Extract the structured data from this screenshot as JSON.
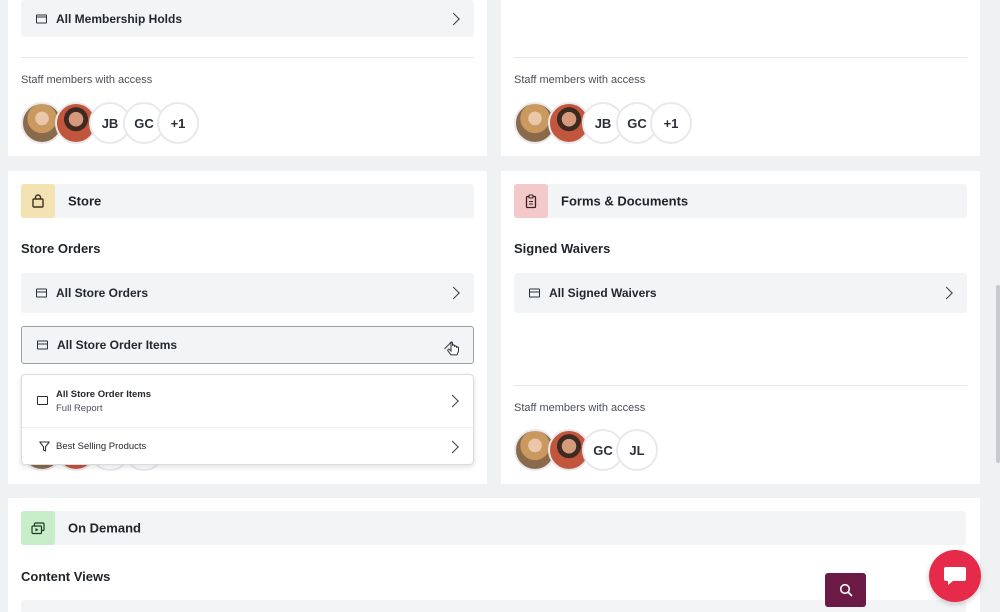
{
  "top_left": {
    "report_row_label": "All Membership Holds",
    "access_label": "Staff members with access",
    "avatars": [
      {
        "type": "photo",
        "name": "staff-photo-1"
      },
      {
        "type": "photo",
        "name": "staff-photo-2"
      },
      {
        "type": "initials",
        "text": "JB"
      },
      {
        "type": "initials",
        "text": "GC"
      },
      {
        "type": "count",
        "text": "+1"
      }
    ]
  },
  "top_right": {
    "access_label": "Staff members with access",
    "avatars": [
      {
        "type": "photo"
      },
      {
        "type": "photo"
      },
      {
        "type": "initials",
        "text": "JB"
      },
      {
        "type": "initials",
        "text": "GC"
      },
      {
        "type": "count",
        "text": "+1"
      }
    ]
  },
  "store": {
    "title": "Store",
    "icon": "shopping-bag-icon",
    "icon_bg": "#f3e3b3",
    "subtitle": "Store Orders",
    "rows": [
      {
        "label": "All Store Orders"
      },
      {
        "label": "All Store Order Items",
        "expanded": true
      }
    ],
    "dropdown": [
      {
        "title": "All Store Order Items",
        "subtitle": "Full Report",
        "icon": "table-icon"
      },
      {
        "title": "Best Selling Products",
        "icon": "filter-icon"
      }
    ]
  },
  "forms": {
    "title": "Forms & Documents",
    "icon": "clipboard-icon",
    "icon_bg": "#f3c9c9",
    "subtitle": "Signed Waivers",
    "rows": [
      {
        "label": "All Signed Waivers"
      }
    ],
    "access_label": "Staff members with access",
    "avatars": [
      {
        "type": "photo"
      },
      {
        "type": "photo"
      },
      {
        "type": "initials",
        "text": "GC"
      },
      {
        "type": "initials",
        "text": "JL"
      }
    ]
  },
  "on_demand": {
    "title": "On Demand",
    "icon": "video-library-icon",
    "icon_bg": "#c7eec9",
    "subtitle": "Content Views"
  },
  "colors": {
    "search_button": "#6b1a45",
    "chat_button": "#e52a4a"
  }
}
